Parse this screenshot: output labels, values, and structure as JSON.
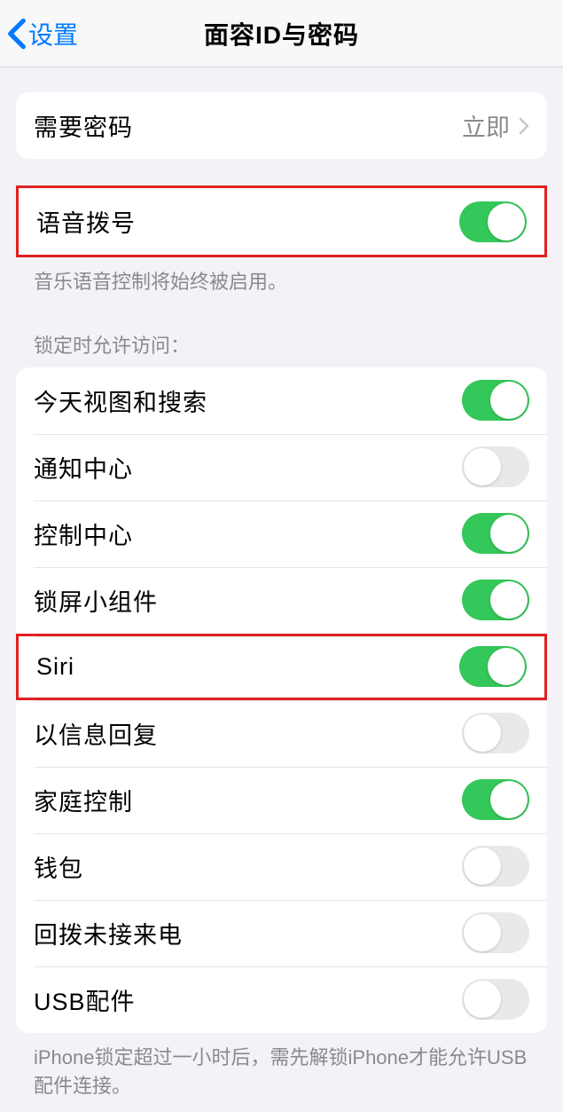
{
  "nav": {
    "back": "设置",
    "title": "面容ID与密码"
  },
  "require_passcode": {
    "label": "需要密码",
    "value": "立即"
  },
  "voice_dial": {
    "label": "语音拨号",
    "on": true,
    "footer": "音乐语音控制将始终被启用。"
  },
  "locked_access": {
    "header": "锁定时允许访问：",
    "items": [
      {
        "label": "今天视图和搜索",
        "on": true
      },
      {
        "label": "通知中心",
        "on": false
      },
      {
        "label": "控制中心",
        "on": true
      },
      {
        "label": "锁屏小组件",
        "on": true
      },
      {
        "label": "Siri",
        "on": true
      },
      {
        "label": "以信息回复",
        "on": false
      },
      {
        "label": "家庭控制",
        "on": true
      },
      {
        "label": "钱包",
        "on": false
      },
      {
        "label": "回拨未接来电",
        "on": false
      },
      {
        "label": "USB配件",
        "on": false
      }
    ],
    "footer": "iPhone锁定超过一小时后，需先解锁iPhone才能允许USB配件连接。"
  }
}
